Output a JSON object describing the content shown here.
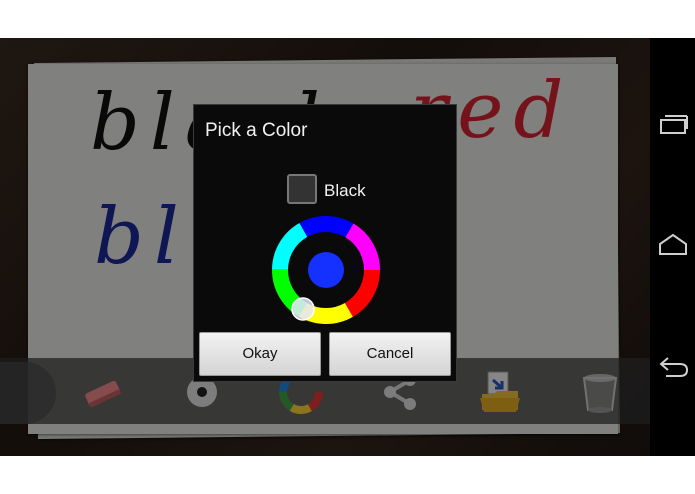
{
  "canvas": {
    "doodles": [
      {
        "text": "black",
        "color": "#121212"
      },
      {
        "text": "red",
        "color": "#d62332"
      },
      {
        "text": "blue",
        "color": "#1b2a9a"
      }
    ]
  },
  "dialog": {
    "title": "Pick a Color",
    "current_color_name": "Black",
    "current_swatch_color": "#333333",
    "selected_color": "#1431ff",
    "okay_label": "Okay",
    "cancel_label": "Cancel"
  },
  "toolbar": {
    "tools": [
      "eraser-icon",
      "brush-size-icon",
      "color-wheel-icon",
      "share-icon",
      "open-folder-icon",
      "trash-can-icon"
    ]
  },
  "navbar": {
    "buttons": [
      "recent-apps-icon",
      "home-icon",
      "back-icon"
    ]
  }
}
